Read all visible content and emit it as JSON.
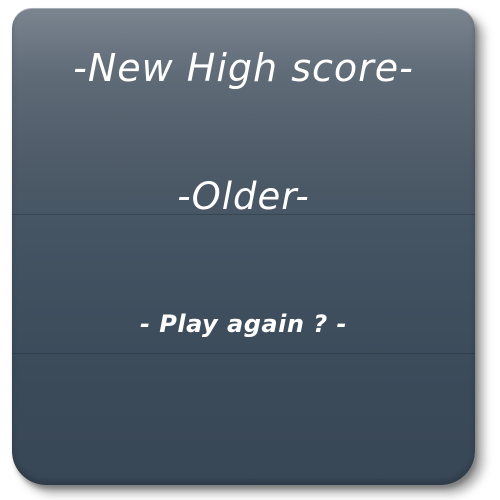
{
  "dialog": {
    "title": "-New High score-",
    "subtitle": "-Older-",
    "play_again_label": "- Play again ? -"
  }
}
